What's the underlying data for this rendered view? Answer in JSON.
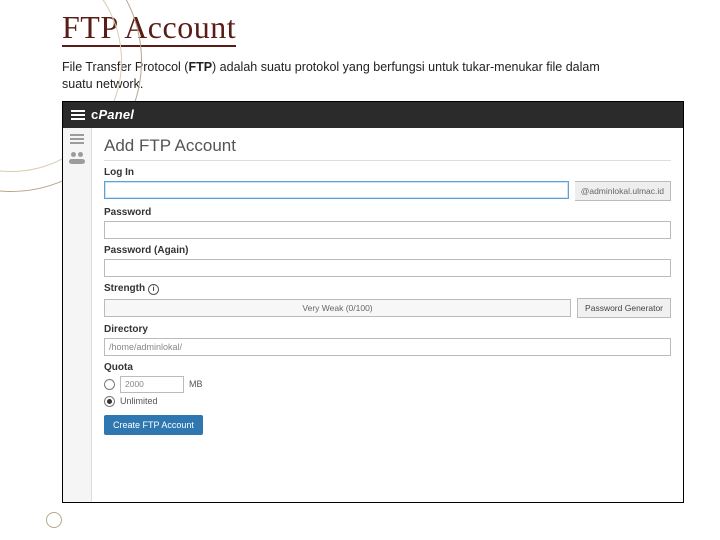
{
  "slide": {
    "title": "FTP Account",
    "subtitle_pre": "File Transfer Protocol (",
    "subtitle_bold": "FTP",
    "subtitle_post": ") adalah suatu protokol yang berfungsi untuk tukar-menukar file dalam suatu network."
  },
  "topbar": {
    "brand_c": "c",
    "brand_rest": "Panel"
  },
  "page": {
    "heading": "Add FTP Account",
    "login_label": "Log In",
    "login_addon": "@adminlokal.ulmac.id",
    "password_label": "Password",
    "password_again_label": "Password (Again)",
    "strength_label": "Strength",
    "strength_text": "Very Weak (0/100)",
    "pw_gen_btn": "Password Generator",
    "directory_label": "Directory",
    "directory_value": "/home/adminlokal/",
    "quota_label": "Quota",
    "quota_value": "2000",
    "quota_unit": "MB",
    "quota_unlimited": "Unlimited",
    "create_btn": "Create FTP Account"
  }
}
